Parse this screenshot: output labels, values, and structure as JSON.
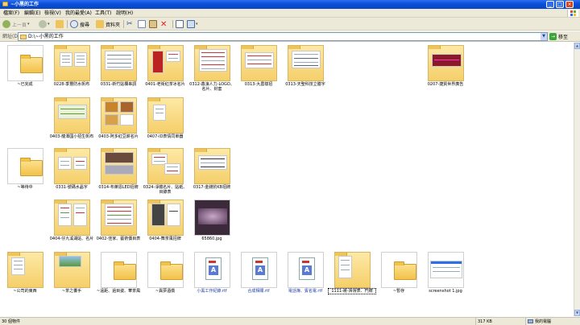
{
  "window": {
    "title": "~小黑的工作",
    "minimize": "_",
    "maximize": "□",
    "close": "×"
  },
  "menu": [
    "檔案(F)",
    "編輯(E)",
    "檢視(V)",
    "我的最愛(A)",
    "工具(T)",
    "說明(H)"
  ],
  "toolbar": {
    "back": "上一頁",
    "search": "搜尋",
    "folders": "資料夾"
  },
  "address": {
    "label": "網址(D)",
    "path": "D:\\~小黑的工作",
    "go": "移至"
  },
  "items": [
    {
      "label": "~已完成",
      "kind": "folder"
    },
    {
      "label": "0228-季豐防水帆布",
      "kind": "folder-thumb"
    },
    {
      "label": "0331-新竹貼欄串調",
      "kind": "folder-thumb"
    },
    {
      "label": "0401-老街紅茶冰名片",
      "kind": "folder-thumb"
    },
    {
      "label": "0312-鑫濠人力-LOGO、名片、封套",
      "kind": "folder-thumb"
    },
    {
      "label": "0313-大農樣招",
      "kind": "folder-thumb"
    },
    {
      "label": "0313-天聖科技立體字",
      "kind": "folder-thumb"
    },
    {
      "label": "0207-捷質世界廣告",
      "kind": "folder-thumb"
    },
    {
      "label": "0403-龍潭國小招生帆布",
      "kind": "folder-thumb"
    },
    {
      "label": "0403-阿多紅豆餅名片",
      "kind": "folder-thumb"
    },
    {
      "label": "0407-ID表情同單器",
      "kind": "folder-thumb"
    },
    {
      "label": "~等待中",
      "kind": "folder"
    },
    {
      "label": "0331-號碼水晶字",
      "kind": "folder-thumb"
    },
    {
      "label": "0314-布萊恩LED招牌",
      "kind": "folder-thumb"
    },
    {
      "label": "0324-淨體名片、貼紙、目錄表",
      "kind": "folder-thumb"
    },
    {
      "label": "0317-金錢豹KB招牌",
      "kind": "folder-thumb"
    },
    {
      "label": "0404-仔九溪湖貼、名片",
      "kind": "folder-thumb"
    },
    {
      "label": "0402-佳家、藝術價目表",
      "kind": "folder-thumb"
    },
    {
      "label": "0404-舞茶風招牌",
      "kind": "folder-thumb"
    },
    {
      "label": "65860.jpg",
      "kind": "photo"
    },
    {
      "label": "~公司的東西",
      "kind": "folder-thumb"
    },
    {
      "label": "~茶之饗手",
      "kind": "folder-thumb"
    },
    {
      "label": "~遠距、過目姿、華茶風",
      "kind": "folder"
    },
    {
      "label": "~異夢酒僑",
      "kind": "folder"
    },
    {
      "label": "小黑工作紀錄.rtf",
      "kind": "rtf"
    },
    {
      "label": "合成相關.rtf",
      "kind": "rtf"
    },
    {
      "label": "電話簿、賓名電.rtf",
      "kind": "rtf"
    },
    {
      "label": "1111-將-滑滑表、門牌",
      "kind": "folder-thumb"
    },
    {
      "label": "~暫存",
      "kind": "folder"
    },
    {
      "label": "screenshot 1.jpg",
      "kind": "screenshot"
    }
  ],
  "status": {
    "count": "30 個物件",
    "size": "317 KB",
    "location": "我的電腦"
  },
  "colors": {
    "titlebar": "#0a4fd8",
    "chrome": "#ece9d8",
    "rtf_label": "#1a3aa8"
  }
}
